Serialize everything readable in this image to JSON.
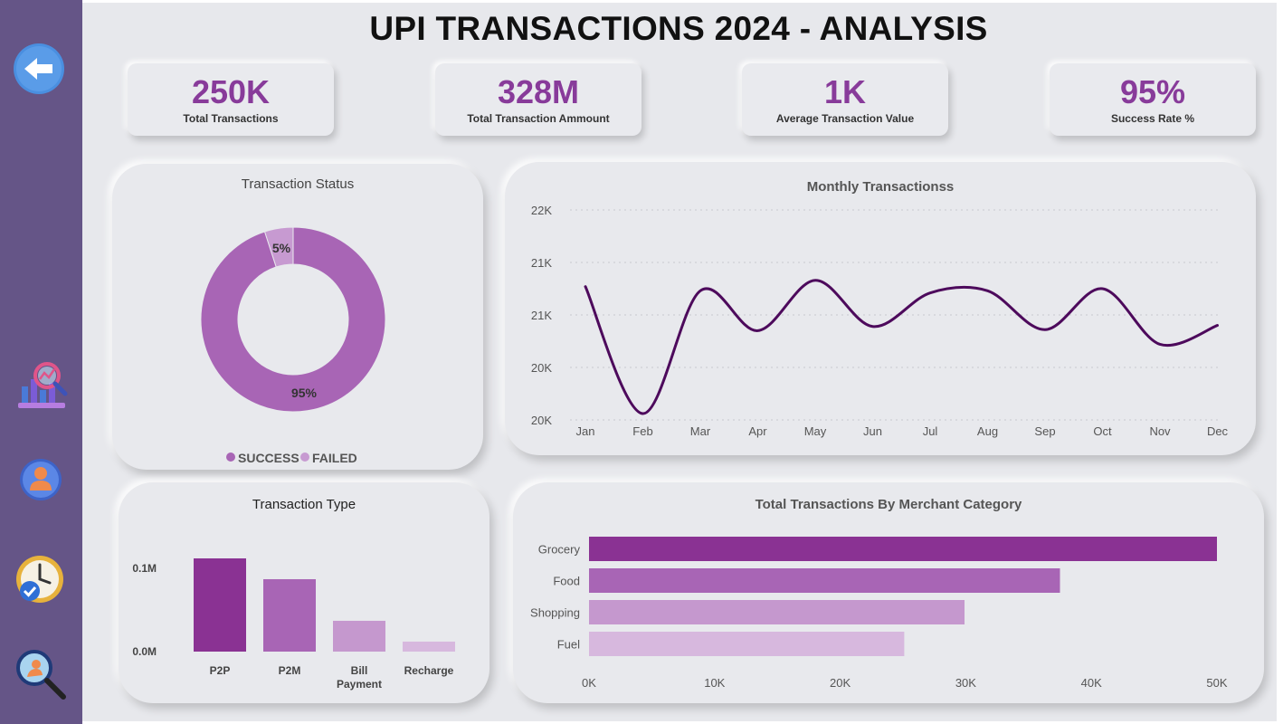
{
  "page": {
    "title": "UPI TRANSACTIONS 2024 - ANALYSIS"
  },
  "sidebar": {
    "items": [
      {
        "name": "back-button",
        "icon": "back-arrow-icon"
      },
      {
        "name": "analytics-nav",
        "icon": "chart-magnifier-icon"
      },
      {
        "name": "user-nav",
        "icon": "user-icon"
      },
      {
        "name": "time-nav",
        "icon": "clock-check-icon"
      },
      {
        "name": "search-nav",
        "icon": "search-icon"
      }
    ]
  },
  "kpis": [
    {
      "value": "250K",
      "label": "Total Transactions"
    },
    {
      "value": "328M",
      "label": "Total Transaction Ammount"
    },
    {
      "value": "1K",
      "label": "Average Transaction Value"
    },
    {
      "value": "95%",
      "label": "Success Rate %"
    }
  ],
  "colors": {
    "accent": "#883b9a",
    "line": "#4d0a5c",
    "grocery": "#8a3293",
    "food": "#a865b5",
    "shopping": "#c598ce",
    "fuel": "#d7b8de",
    "success": "#a865b5",
    "failed": "#c79ad1"
  },
  "chart_data": [
    {
      "id": "status",
      "type": "pie",
      "title": "Transaction Status",
      "categories": [
        "SUCCESS",
        "FAILED"
      ],
      "values": [
        95,
        5
      ],
      "labels": [
        "95%",
        "5%"
      ],
      "legend": "bottom"
    },
    {
      "id": "monthly",
      "type": "line",
      "title": "Monthly Transactionss",
      "x": [
        "Jan",
        "Feb",
        "Mar",
        "Apr",
        "May",
        "Jun",
        "Jul",
        "Aug",
        "Sep",
        "Oct",
        "Nov",
        "Dec"
      ],
      "values": [
        21270,
        20060,
        21230,
        20850,
        21330,
        20890,
        21210,
        21230,
        20860,
        21250,
        20720,
        20900
      ],
      "ylim": [
        20000,
        22000
      ],
      "yticks": [
        20000,
        20500,
        21000,
        21500,
        22000
      ],
      "ytick_labels": [
        "20K",
        "20K",
        "21K",
        "21K",
        "22K"
      ],
      "grid": true
    },
    {
      "id": "type",
      "type": "bar",
      "title": "Transaction Type",
      "categories": [
        "P2P",
        "P2M",
        "Bill Payment",
        "Recharge"
      ],
      "category_lines": [
        [
          "P2P"
        ],
        [
          "P2M"
        ],
        [
          "Bill",
          "Payment"
        ],
        [
          "Recharge"
        ]
      ],
      "values": [
        112000,
        87000,
        37000,
        12000
      ],
      "ylim": [
        0,
        112000
      ],
      "yticks": [
        0,
        100000
      ],
      "ytick_labels": [
        "0.0M",
        "0.1M"
      ]
    },
    {
      "id": "merchant",
      "type": "bar",
      "orientation": "horizontal",
      "title": "Total Transactions By Merchant Category",
      "categories": [
        "Grocery",
        "Food",
        "Shopping",
        "Fuel"
      ],
      "values": [
        50000,
        37500,
        29900,
        25100
      ],
      "xlim": [
        0,
        50000
      ],
      "xticks": [
        0,
        10000,
        20000,
        30000,
        40000,
        50000
      ],
      "xtick_labels": [
        "0K",
        "10K",
        "20K",
        "30K",
        "40K",
        "50K"
      ]
    }
  ]
}
